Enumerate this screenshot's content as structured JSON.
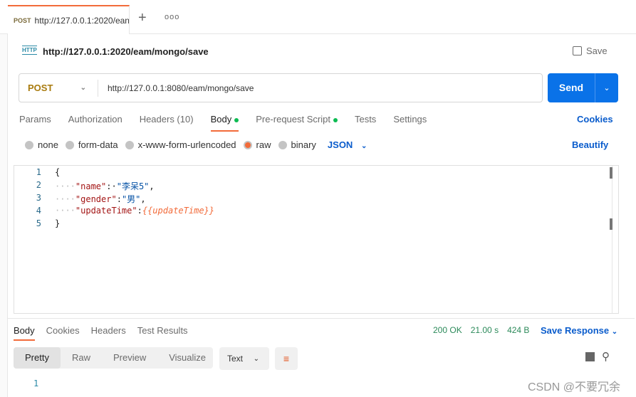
{
  "tab": {
    "method": "POST",
    "url": "http://127.0.0.1:2020/ean"
  },
  "header": {
    "title": "http://127.0.0.1:2020/eam/mongo/save",
    "save": "Save",
    "http_icon": "HTTP"
  },
  "request": {
    "method": "POST",
    "url": "http://127.0.0.1:8080/eam/mongo/save",
    "send": "Send"
  },
  "req_tabs": [
    "Params",
    "Authorization",
    "Headers (10)",
    "Body",
    "Pre-request Script",
    "Tests",
    "Settings"
  ],
  "cookies": "Cookies",
  "body_types": [
    "none",
    "form-data",
    "x-www-form-urlencoded",
    "raw",
    "binary"
  ],
  "body_type_selected": "raw",
  "language": "JSON",
  "beautify": "Beautify",
  "editor": {
    "line_numbers": [
      "1",
      "2",
      "3",
      "4",
      "5"
    ],
    "lines": [
      {
        "t": "{"
      },
      {
        "k": "\"name\"",
        "sep": ":·",
        "v": "\"李呆5\"",
        "end": ","
      },
      {
        "k": "\"gender\"",
        "sep": ":",
        "v": "\"男\"",
        "end": ","
      },
      {
        "k": "\"updateTime\"",
        "sep": ":",
        "var": "{{updateTime}}"
      },
      {
        "t": "}"
      }
    ]
  },
  "response": {
    "tabs": [
      "Body",
      "Cookies",
      "Headers",
      "Test Results"
    ],
    "status": "200 OK",
    "time": "21.00 s",
    "size": "424 B",
    "save_response": "Save Response",
    "views": [
      "Pretty",
      "Raw",
      "Preview",
      "Visualize"
    ],
    "format": "Text",
    "line1": "1"
  },
  "watermark": "CSDN @不要冗余"
}
